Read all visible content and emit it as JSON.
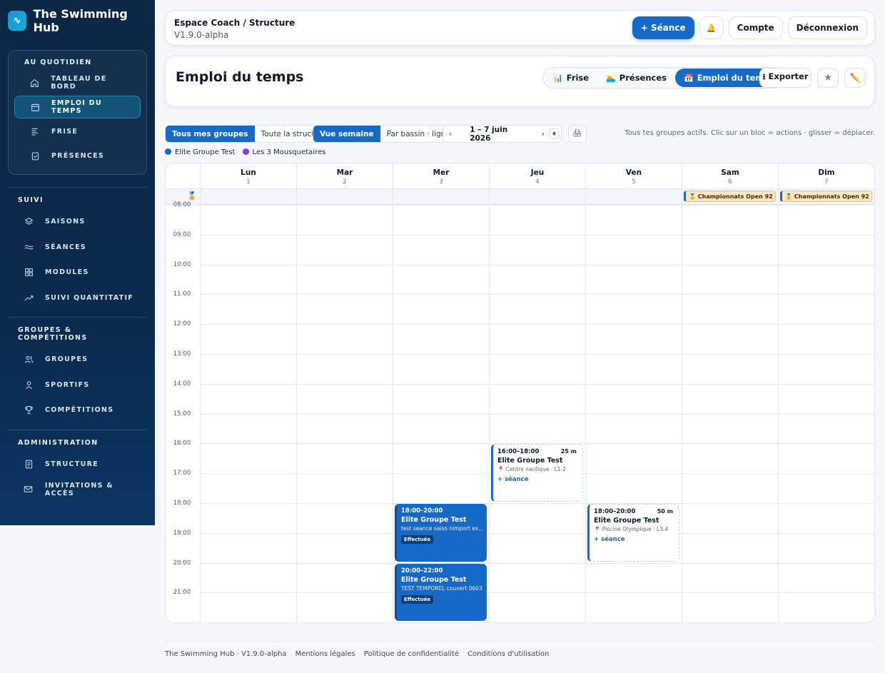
{
  "brand": {
    "name": "The Swimming Hub",
    "logo": "wave-icon"
  },
  "sidebar": {
    "daily": {
      "title": "AU QUOTIDIEN",
      "items": [
        {
          "label": "TABLEAU DE BORD",
          "icon": "home-icon"
        },
        {
          "label": "EMPLOI DU TEMPS",
          "icon": "calendar-icon",
          "active": true
        },
        {
          "label": "FRISE",
          "icon": "timeline-icon"
        },
        {
          "label": "PRÉSENCES",
          "icon": "clipboard-check-icon"
        }
      ]
    },
    "suivi": {
      "title": "SUIVI",
      "items": [
        {
          "label": "SAISONS",
          "icon": "layers-icon"
        },
        {
          "label": "SÉANCES",
          "icon": "waves-icon"
        },
        {
          "label": "MODULES",
          "icon": "grid-icon"
        },
        {
          "label": "SUIVI QUANTITATIF",
          "icon": "trend-icon"
        }
      ]
    },
    "groups": {
      "title": "GROUPES & COMPÉTITIONS",
      "items": [
        {
          "label": "GROUPES",
          "icon": "users-icon"
        },
        {
          "label": "SPORTIFS",
          "icon": "user-icon"
        },
        {
          "label": "COMPÉTITIONS",
          "icon": "trophy-icon"
        }
      ]
    },
    "admin": {
      "title": "ADMINISTRATION",
      "items": [
        {
          "label": "STRUCTURE",
          "icon": "document-icon"
        },
        {
          "label": "INVITATIONS & ACCÈS",
          "icon": "mail-icon"
        }
      ]
    }
  },
  "topbar": {
    "breadcrumb": "Espace Coach / Structure",
    "version": "V1.9.0-alpha",
    "new_session": "+ Séance",
    "bell": "🔔",
    "account": "Compte",
    "logout": "Déconnexion"
  },
  "header": {
    "title": "Emploi du temps",
    "tabs": [
      {
        "label": "Frise",
        "icon": "📊"
      },
      {
        "label": "Présences",
        "icon": "🏊"
      },
      {
        "label": "Emploi du temps",
        "icon": "📅",
        "active": true
      }
    ],
    "export": "⭳ Exporter",
    "star": "★",
    "edit": "✏️"
  },
  "toolbar": {
    "scope": [
      "Tous mes groupes",
      "Toute la structure"
    ],
    "view": [
      "Vue semaine",
      "Par bassin · lignes"
    ],
    "prev": "‹",
    "range": "1 – 7 juin 2026",
    "next": "›",
    "today": "♦",
    "print": "🖨",
    "hint": "Tous tes groupes actifs. Clic sur un bloc = actions · glisser = déplacer."
  },
  "legend": [
    {
      "label": "Elite Groupe Test",
      "color": "#1769c8"
    },
    {
      "label": "Les 3 Mousquetaires",
      "color": "#7b3fe4"
    }
  ],
  "calendar": {
    "days": [
      {
        "name": "Lun",
        "num": "1"
      },
      {
        "name": "Mar",
        "num": "2"
      },
      {
        "name": "Mer",
        "num": "3"
      },
      {
        "name": "Jeu",
        "num": "4"
      },
      {
        "name": "Ven",
        "num": "5"
      },
      {
        "name": "Sam",
        "num": "6"
      },
      {
        "name": "Dim",
        "num": "7"
      }
    ],
    "allday_icon": "🏅",
    "competitions": [
      {
        "day": 5,
        "label": "🏅 Championnats Open 92"
      },
      {
        "day": 6,
        "label": "🏅 Championnats Open 92"
      }
    ],
    "hours": [
      "08:00",
      "09:00",
      "10:00",
      "11:00",
      "12:00",
      "13:00",
      "14:00",
      "15:00",
      "16:00",
      "17:00",
      "18:00",
      "19:00",
      "20:00",
      "21:00"
    ],
    "blocks": [
      {
        "day": 3,
        "start": 16,
        "end": 18,
        "kind": "slot",
        "time": "16:00–18:00",
        "dur": "25 m",
        "group": "Elite Groupe Test",
        "loc": "📍 Centre nautique · L1-2",
        "add": "+ séance"
      },
      {
        "day": 2,
        "start": 18,
        "end": 20,
        "kind": "done",
        "time": "18:00–20:00",
        "group": "Elite Groupe Test",
        "loc": "test seance saiso nimport ex...",
        "badge": "Effectuée"
      },
      {
        "day": 4,
        "start": 18,
        "end": 20,
        "kind": "slot",
        "time": "18:00–20:00",
        "dur": "50 m",
        "group": "Elite Groupe Test",
        "loc": "📍 Piscine Olympique · L3-4",
        "add": "+ séance"
      },
      {
        "day": 2,
        "start": 20,
        "end": 22,
        "kind": "done",
        "time": "20:00–22:00",
        "group": "Elite Groupe Test",
        "loc": "TEST TEMPOREL couvert 0603",
        "badge": "Effectuée"
      }
    ]
  },
  "footer": [
    "The Swimming Hub · V1.9.0-alpha",
    "Mentions légales",
    "Politique de confidentialité",
    "Conditions d'utilisation"
  ]
}
